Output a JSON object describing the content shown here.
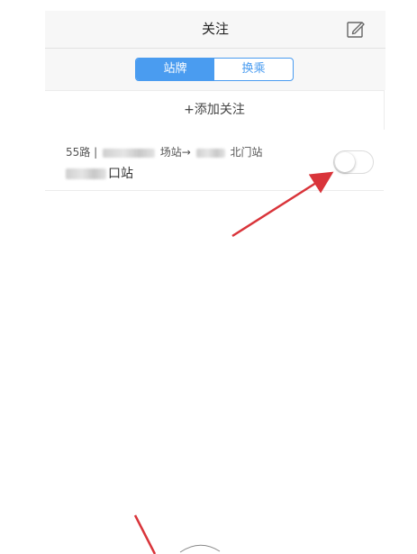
{
  "nav": {
    "title": "关注",
    "edit_icon": "edit-icon"
  },
  "tabs": [
    {
      "label": "站牌",
      "active": true
    },
    {
      "label": "换乘",
      "active": false
    }
  ],
  "add_follow": {
    "label": "+添加关注"
  },
  "followed_items": [
    {
      "route_prefix": "55路 |",
      "from_suffix": "场站→",
      "to_suffix": "北门站",
      "stop_suffix": "口站",
      "notify_enabled": false
    }
  ],
  "colors": {
    "accent": "#4a9cf0",
    "annotation_arrow": "#d9343a"
  }
}
